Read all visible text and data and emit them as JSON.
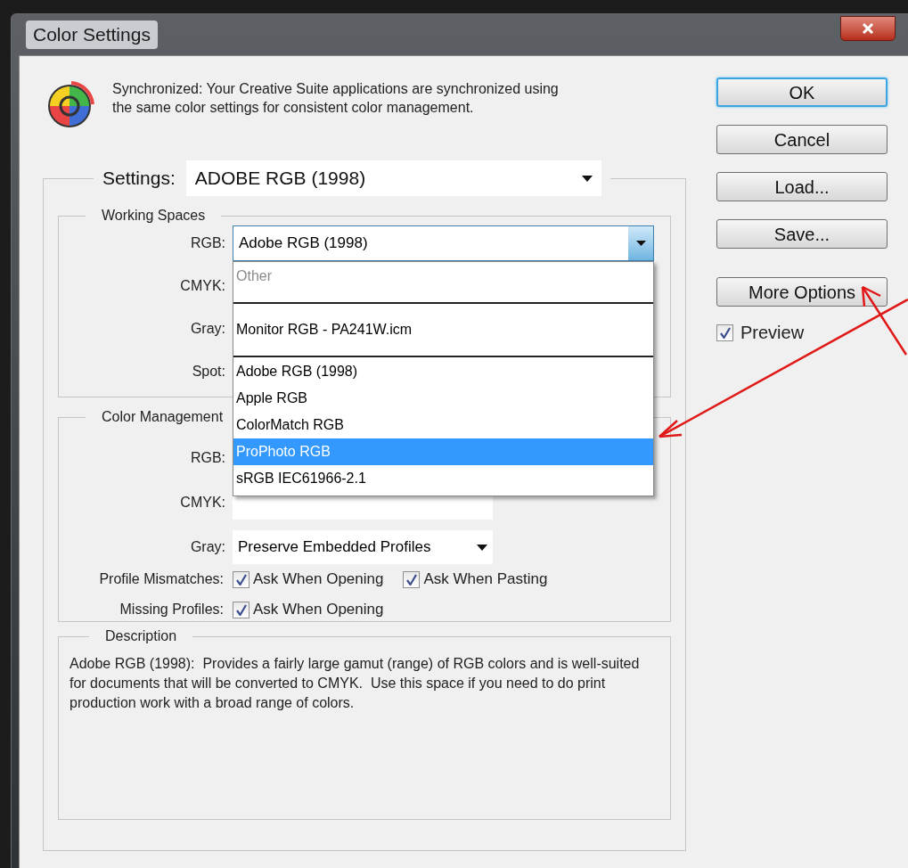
{
  "window": {
    "title": "Color Settings"
  },
  "sync_message": "Synchronized: Your Creative Suite applications are synchronized using the same color settings for consistent color management.",
  "settings": {
    "label": "Settings:",
    "value": "ADOBE RGB (1998)"
  },
  "working_spaces": {
    "title": "Working Spaces",
    "rows": [
      {
        "label": "RGB:",
        "value": "Adobe RGB (1998)",
        "open": true
      },
      {
        "label": "CMYK:"
      },
      {
        "label": "Gray:"
      },
      {
        "label": "Spot:"
      }
    ]
  },
  "rgb_menu": {
    "items": [
      {
        "kind": "header",
        "label": "Other"
      },
      {
        "kind": "separator"
      },
      {
        "kind": "option",
        "label": "Monitor RGB - PA241W.icm",
        "selected": false
      },
      {
        "kind": "separator"
      },
      {
        "kind": "option",
        "label": "Adobe RGB (1998)",
        "selected": false
      },
      {
        "kind": "option",
        "label": "Apple RGB",
        "selected": false
      },
      {
        "kind": "option",
        "label": "ColorMatch RGB",
        "selected": false
      },
      {
        "kind": "option",
        "label": "ProPhoto RGB",
        "selected": true
      },
      {
        "kind": "option",
        "label": "sRGB IEC61966-2.1",
        "selected": false
      }
    ]
  },
  "color_management": {
    "title": "Color Management",
    "rows": [
      {
        "label": "RGB:",
        "covered": true
      },
      {
        "label": "CMYK:"
      },
      {
        "label": "Gray:",
        "value": "Preserve Embedded Profiles"
      }
    ]
  },
  "profile_mismatches": {
    "label": "Profile Mismatches:",
    "options": [
      {
        "label": "Ask When Opening",
        "checked": true
      },
      {
        "label": "Ask When Pasting",
        "checked": true
      }
    ]
  },
  "missing_profiles": {
    "label": "Missing Profiles:",
    "options": [
      {
        "label": "Ask When Opening",
        "checked": true
      }
    ]
  },
  "description": {
    "title": "Description",
    "text": "Adobe RGB (1998):  Provides a fairly large gamut (range) of RGB colors and is well-suited for documents that will be converted to CMYK.  Use this space if you need to do print production work with a broad range of colors."
  },
  "buttons": [
    {
      "label": "OK",
      "default": true
    },
    {
      "label": "Cancel",
      "default": false
    },
    {
      "label": "Load...",
      "default": false
    },
    {
      "label": "Save...",
      "default": false
    },
    {
      "label": "More Options",
      "default": false
    }
  ],
  "preview": {
    "label": "Preview",
    "checked": true
  }
}
